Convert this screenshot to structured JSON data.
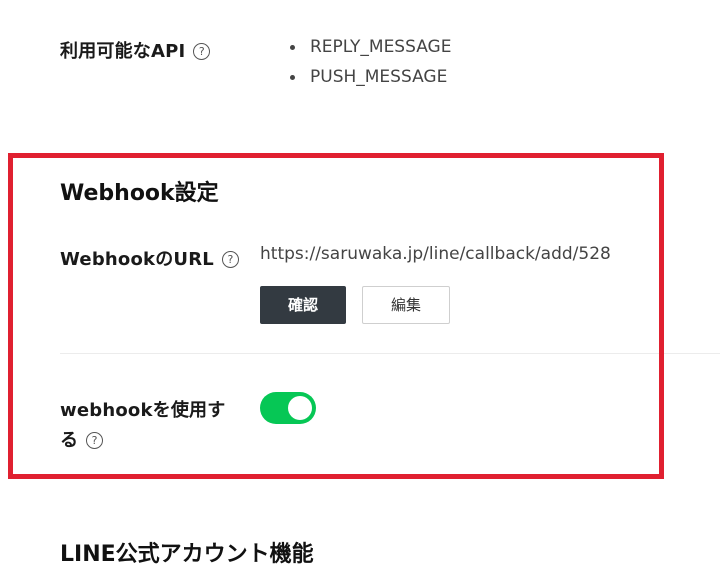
{
  "available_api": {
    "label": "利用可能なAPI",
    "help": "?",
    "items": [
      "REPLY_MESSAGE",
      "PUSH_MESSAGE"
    ]
  },
  "webhook_settings": {
    "title": "Webhook設定",
    "url_row": {
      "label": "WebhookのURL",
      "help": "?",
      "value": "https://saruwaka.jp/line/callback/add/528",
      "verify_button": "確認",
      "edit_button": "編集"
    },
    "use_webhook": {
      "label_line1": "webhookを使用す",
      "label_line2": "る",
      "help": "?",
      "enabled": true,
      "toggle_color": "#06c755"
    }
  },
  "line_features": {
    "title": "LINE公式アカウント機能"
  },
  "colors": {
    "highlight_border": "#e02030",
    "primary_button": "#333a41",
    "toggle_on": "#06c755"
  }
}
